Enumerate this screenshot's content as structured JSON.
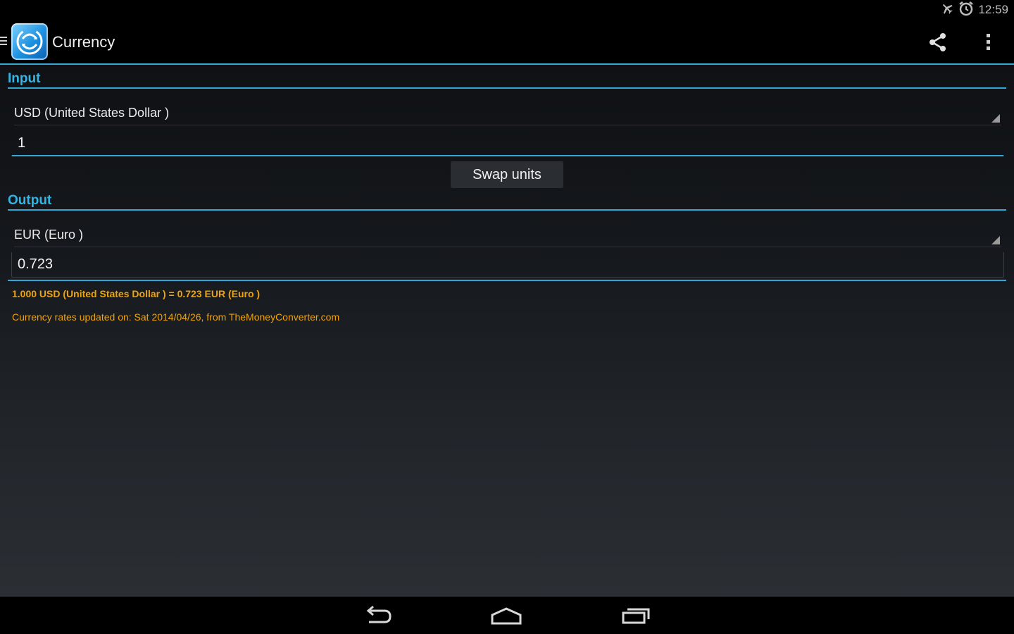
{
  "status_bar": {
    "time": "12:59",
    "icons": [
      "airplane-mode-icon",
      "alarm-icon"
    ]
  },
  "action_bar": {
    "title": "Currency",
    "icons": [
      "drawer-icon",
      "app-logo-icon",
      "share-icon",
      "overflow-menu-icon"
    ]
  },
  "input": {
    "header": "Input",
    "currency": "USD (United States Dollar )",
    "amount": "1"
  },
  "swap": {
    "label": "Swap units"
  },
  "output": {
    "header": "Output",
    "currency": "EUR (Euro )",
    "amount": "0.723"
  },
  "info": {
    "result": "1.000 USD (United States Dollar ) = 0.723 EUR (Euro )",
    "rates_updated": "Currency rates updated on: Sat 2014/04/26, from TheMoneyConverter.com"
  },
  "nav_bar": {
    "icons": [
      "back-icon",
      "home-icon",
      "recent-apps-icon"
    ]
  },
  "colors": {
    "accent": "#33b5e5",
    "info_text": "#f0a30a"
  }
}
